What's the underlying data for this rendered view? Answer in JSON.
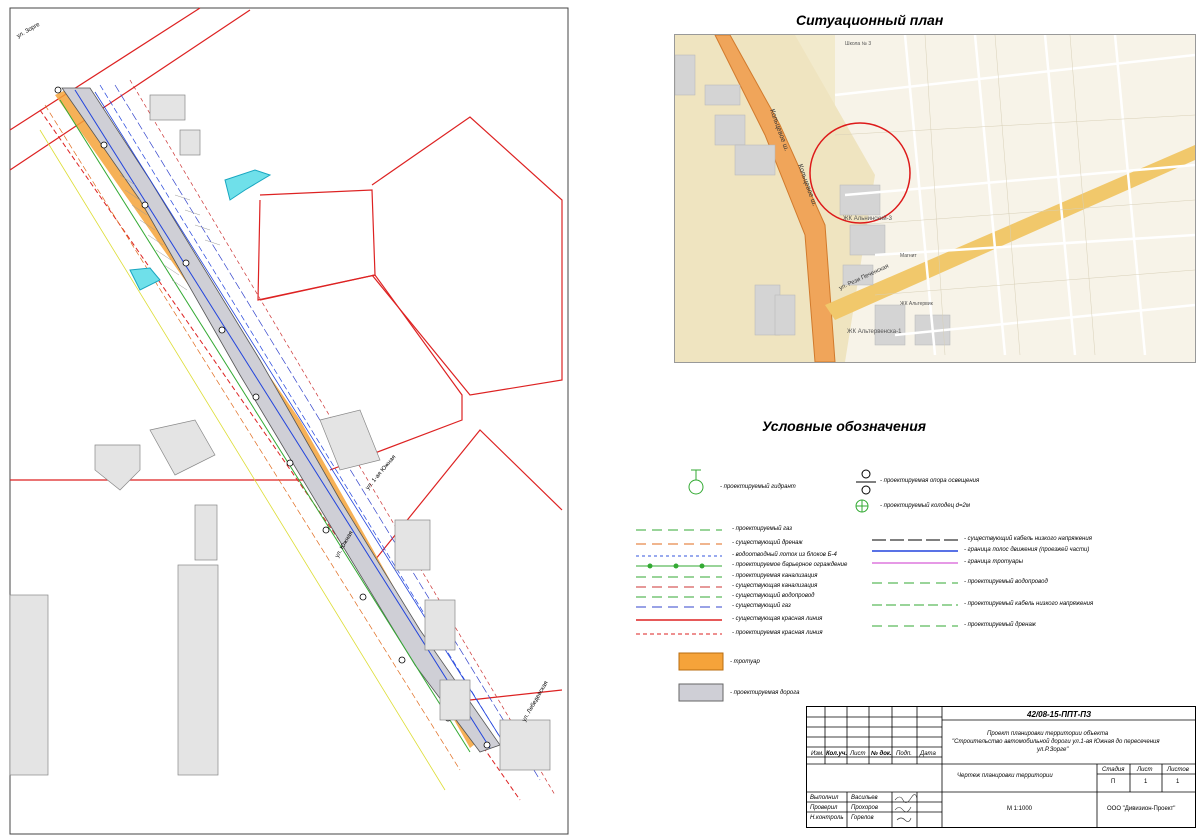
{
  "situation_plan": {
    "title": "Ситуационный план",
    "map_labels": {
      "lanskoe": "Кольцевое ш.",
      "lanskoe2": "Кольцевое ш.",
      "alhanay": "ЖК Альнинский-3",
      "reza": "ул. Рези Печенская",
      "altuf": "ЖК Альтервенска-1",
      "school": "Школа № 3",
      "magnit": "Магнит",
      "fat": "ЖК Альтервик"
    }
  },
  "legend": {
    "title": "Условные обозначения",
    "symbols": [
      {
        "label": "- проектируемый гидрант"
      },
      {
        "label": "- проектируемая опора освещения"
      },
      {
        "label": "- проектируемый колодец  d=2м"
      }
    ],
    "lines_left": [
      {
        "code": "Г",
        "label": "- проектируемый газ",
        "color": "#33aa33"
      },
      {
        "code": "Др",
        "label": "- существующий дренаж",
        "color": "#e06b1e"
      },
      {
        "code": "",
        "label": "- водоотводный лоток из блоков Б-4",
        "color": "#3355dd"
      },
      {
        "code": "",
        "label": "- проектируемое барьерное ограждение",
        "color": "#33aa33"
      },
      {
        "code": "К",
        "label": "- проектируемая канализация",
        "color": "#33aa33"
      },
      {
        "code": "К",
        "label": "- существующая канализация",
        "color": "#cc3333"
      },
      {
        "code": "В",
        "label": "- существующий водопровод",
        "color": "#33aa33"
      },
      {
        "code": "Г",
        "label": "- существующий газ",
        "color": "#3344cc"
      },
      {
        "code": "",
        "label": "- существующая красная линия",
        "color": "#dd2222"
      },
      {
        "code": "",
        "label": "- проектируемая красная линия",
        "color": "#dd2222"
      }
    ],
    "lines_right": [
      {
        "label": "- существующий кабель низкого напряжения",
        "color": "#000000"
      },
      {
        "label": "- граница полос движения (проезжей части)",
        "color": "#2244dd"
      },
      {
        "label": "- граница тротуары",
        "color": "#cc33cc"
      },
      {
        "code": "В",
        "label": "- проектируемый водопровод",
        "color": "#33aa33"
      },
      {
        "label": "- проектируемый кабель низкого напряжения",
        "color": "#33aa33"
      },
      {
        "code": "Др",
        "label": "- проектируемый дренаж",
        "color": "#33aa33"
      }
    ],
    "fills": [
      {
        "label": "- тротуар",
        "color": "#f5a33a"
      },
      {
        "label": "- проектируемая дорога",
        "color": "#cfcfd6"
      }
    ]
  },
  "plan_labels": {
    "street1": "ул. 1-ая Южная",
    "street2": "ул. Южная",
    "street3": "ул. Лебедевская",
    "street4": "ул. Зорге"
  },
  "stamp": {
    "code": "42/08-15-ППТ-ПЗ",
    "project_line1": "Проект планировки территории объекта",
    "project_line2": "\"Строительство автомобильной дороги ул.1-ая Южная до пересечения",
    "project_line3": "ул.Р.Зорге\"",
    "headers": {
      "izm": "Изм.",
      "kol": "Кол.уч.",
      "list": "Лист",
      "doc": "№ док.",
      "podp": "Подп.",
      "data": "Дата"
    },
    "drawing_name": "Чертеж планировки территории",
    "col_stage": "Стадия",
    "col_sheet": "Лист",
    "col_sheets": "Листов",
    "val_stage": "П",
    "val_sheet": "1",
    "val_sheets": "1",
    "roles": [
      {
        "role": "Выполнил",
        "name": "Васильев"
      },
      {
        "role": "Проверил",
        "name": "Прохоров"
      },
      {
        "role": "Н.контроль",
        "name": "Горелов"
      }
    ],
    "scale": "М 1:1000",
    "company": "ООО \"Дивизион-Проект\""
  }
}
